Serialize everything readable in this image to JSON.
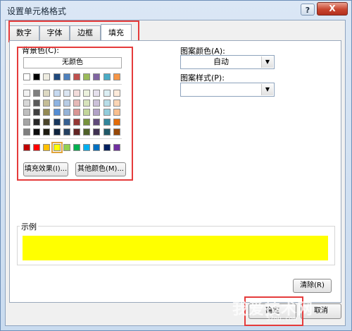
{
  "window": {
    "title": "设置单元格格式",
    "help_label": "?",
    "close_label": "X"
  },
  "tabs": [
    {
      "label": "数字",
      "active": false
    },
    {
      "label": "字体",
      "active": false
    },
    {
      "label": "边框",
      "active": false
    },
    {
      "label": "填充",
      "active": true
    }
  ],
  "background": {
    "label": "背景色(C):",
    "no_color_label": "无颜色",
    "row_top": [
      "#ffffff",
      "#000000",
      "#eeece1",
      "#1f497d",
      "#4f81bd",
      "#c0504d",
      "#9bbb59",
      "#8064a2",
      "#4bacc6",
      "#f79646"
    ],
    "theme_rows": [
      [
        "#f2f2f2",
        "#7f7f7f",
        "#ddd9c3",
        "#c6d9f0",
        "#dbe5f1",
        "#f2dcdb",
        "#ebf1dd",
        "#e5e0ec",
        "#dbeef3",
        "#fdeada"
      ],
      [
        "#d8d8d8",
        "#595959",
        "#c4bd97",
        "#8db3e2",
        "#b8cce4",
        "#e5b9b7",
        "#d7e3bc",
        "#ccc1d9",
        "#b7dde8",
        "#fbd5b5"
      ],
      [
        "#bfbfbf",
        "#3f3f3f",
        "#938953",
        "#548dd4",
        "#95b3d7",
        "#d99694",
        "#c3d69b",
        "#b2a2c7",
        "#92cddc",
        "#fac08f"
      ],
      [
        "#a5a5a5",
        "#262626",
        "#494429",
        "#17365d",
        "#366092",
        "#953734",
        "#76923c",
        "#5f497a",
        "#31859b",
        "#e36c09"
      ],
      [
        "#7f7f7f",
        "#0c0c0c",
        "#1d1b10",
        "#0f243e",
        "#244061",
        "#632423",
        "#4f6128",
        "#3f3151",
        "#205867",
        "#974806"
      ]
    ],
    "standard_row": [
      "#c00000",
      "#ff0000",
      "#ffc000",
      "#ffff00",
      "#92d050",
      "#00b050",
      "#00b0f0",
      "#0070c0",
      "#002060",
      "#7030a0"
    ],
    "fill_effects_label": "填充效果(I)...",
    "more_colors_label": "其他颜色(M)..."
  },
  "pattern": {
    "color_label": "图案颜色(A):",
    "color_value": "自动",
    "style_label": "图案样式(P):",
    "style_value": ""
  },
  "sample": {
    "label": "示例",
    "fill_color": "#ffff00"
  },
  "buttons": {
    "clear_label": "清除(R)",
    "ok_label": "确定",
    "cancel_label": "取消"
  },
  "watermark": {
    "text": "我爱技术网",
    "sub": "52ou.com"
  },
  "annotation_color": "#e53b3b"
}
